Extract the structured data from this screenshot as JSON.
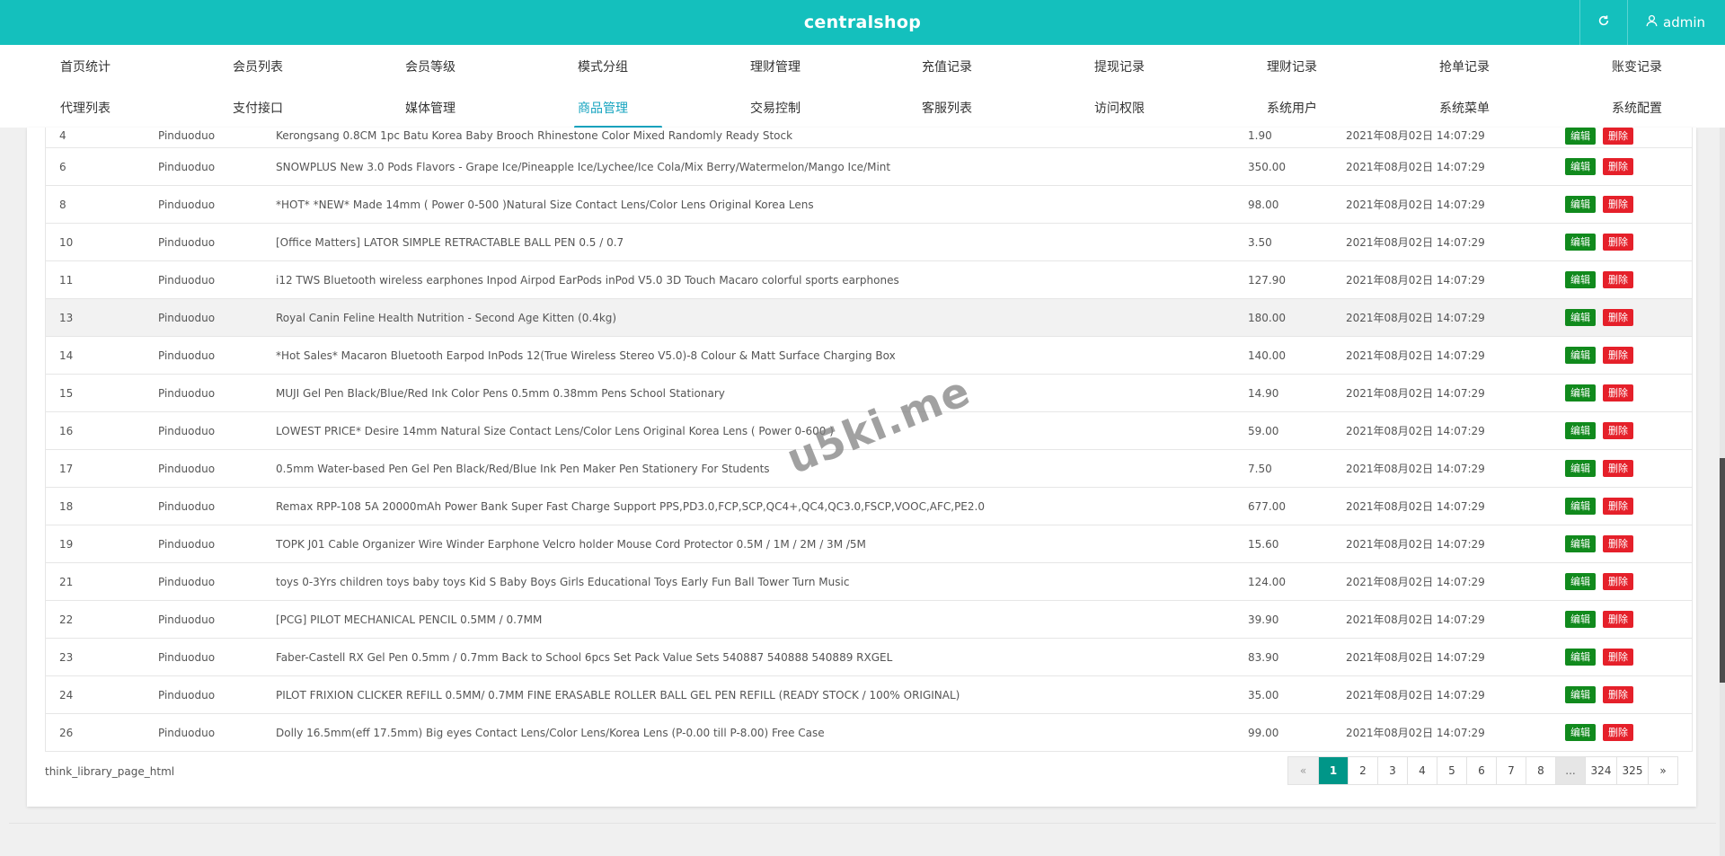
{
  "header": {
    "brand": "centralshop",
    "refresh_icon": "refresh-icon",
    "user_icon": "user-icon",
    "user": "admin"
  },
  "nav": {
    "row1": [
      "首页统计",
      "会员列表",
      "会员等级",
      "模式分组",
      "理财管理",
      "充值记录",
      "提现记录",
      "理财记录",
      "抢单记录",
      "账变记录"
    ],
    "row2": [
      "代理列表",
      "支付接口",
      "媒体管理",
      "商品管理",
      "交易控制",
      "客服列表",
      "访问权限",
      "系统用户",
      "系统菜单",
      "系统配置"
    ],
    "active": "商品管理"
  },
  "table": {
    "edit_label": "编辑",
    "delete_label": "删除",
    "rows": [
      {
        "id": "4",
        "source": "Pinduoduo",
        "name": "Kerongsang 0.8CM 1pc Batu Korea Baby Brooch Rhinestone Color Mixed Randomly Ready Stock",
        "price": "1.90",
        "time": "2021年08月02日 14:07:29"
      },
      {
        "id": "6",
        "source": "Pinduoduo",
        "name": "SNOWPLUS New 3.0 Pods Flavors - Grape Ice/Pineapple Ice/Lychee/Ice Cola/Mix Berry/Watermelon/Mango Ice/Mint",
        "price": "350.00",
        "time": "2021年08月02日 14:07:29"
      },
      {
        "id": "8",
        "source": "Pinduoduo",
        "name": "*HOT* *NEW* Made 14mm ( Power 0-500 )Natural Size Contact Lens/Color Lens Original Korea Lens",
        "price": "98.00",
        "time": "2021年08月02日 14:07:29"
      },
      {
        "id": "10",
        "source": "Pinduoduo",
        "name": "[Office Matters] LATOR SIMPLE RETRACTABLE BALL PEN 0.5 / 0.7",
        "price": "3.50",
        "time": "2021年08月02日 14:07:29"
      },
      {
        "id": "11",
        "source": "Pinduoduo",
        "name": "i12 TWS Bluetooth wireless earphones Inpod Airpod EarPods inPod V5.0 3D Touch Macaro colorful sports earphones",
        "price": "127.90",
        "time": "2021年08月02日 14:07:29"
      },
      {
        "id": "13",
        "source": "Pinduoduo",
        "name": "Royal Canin Feline Health Nutrition - Second Age Kitten (0.4kg)",
        "price": "180.00",
        "time": "2021年08月02日 14:07:29"
      },
      {
        "id": "14",
        "source": "Pinduoduo",
        "name": "*Hot Sales* Macaron Bluetooth Earpod InPods 12(True Wireless Stereo V5.0)-8 Colour & Matt Surface Charging Box",
        "price": "140.00",
        "time": "2021年08月02日 14:07:29"
      },
      {
        "id": "15",
        "source": "Pinduoduo",
        "name": "MUJI Gel Pen Black/Blue/Red Ink Color Pens 0.5mm 0.38mm Pens School Stationary",
        "price": "14.90",
        "time": "2021年08月02日 14:07:29"
      },
      {
        "id": "16",
        "source": "Pinduoduo",
        "name": "LOWEST PRICE* Desire 14mm Natural Size Contact Lens/Color Lens Original Korea Lens ( Power 0-600 )",
        "price": "59.00",
        "time": "2021年08月02日 14:07:29"
      },
      {
        "id": "17",
        "source": "Pinduoduo",
        "name": "0.5mm Water-based Pen Gel Pen Black/Red/Blue Ink Pen Maker Pen Stationery For Students",
        "price": "7.50",
        "time": "2021年08月02日 14:07:29"
      },
      {
        "id": "18",
        "source": "Pinduoduo",
        "name": "Remax RPP-108 5A 20000mAh Power Bank Super Fast Charge Support PPS,PD3.0,FCP,SCP,QC4+,QC4,QC3.0,FSCP,VOOC,AFC,PE2.0",
        "price": "677.00",
        "time": "2021年08月02日 14:07:29"
      },
      {
        "id": "19",
        "source": "Pinduoduo",
        "name": "TOPK J01 Cable Organizer Wire Winder Earphone Velcro holder Mouse Cord Protector 0.5M / 1M / 2M / 3M /5M",
        "price": "15.60",
        "time": "2021年08月02日 14:07:29"
      },
      {
        "id": "21",
        "source": "Pinduoduo",
        "name": "toys 0-3Yrs children toys baby toys Kid S Baby Boys Girls Educational Toys Early Fun Ball Tower Turn Music",
        "price": "124.00",
        "time": "2021年08月02日 14:07:29"
      },
      {
        "id": "22",
        "source": "Pinduoduo",
        "name": "[PCG] PILOT MECHANICAL PENCIL 0.5MM / 0.7MM",
        "price": "39.90",
        "time": "2021年08月02日 14:07:29"
      },
      {
        "id": "23",
        "source": "Pinduoduo",
        "name": "Faber-Castell RX Gel Pen 0.5mm / 0.7mm Back to School 6pcs Set Pack Value Sets 540887 540888 540889 RXGEL",
        "price": "83.90",
        "time": "2021年08月02日 14:07:29"
      },
      {
        "id": "24",
        "source": "Pinduoduo",
        "name": "PILOT FRIXION CLICKER REFILL 0.5MM/ 0.7MM FINE ERASABLE ROLLER BALL GEL PEN REFILL (READY STOCK / 100% ORIGINAL)",
        "price": "35.00",
        "time": "2021年08月02日 14:07:29"
      },
      {
        "id": "26",
        "source": "Pinduoduo",
        "name": "Dolly 16.5mm(eff 17.5mm) Big eyes Contact Lens/Color Lens/Korea Lens (P-0.00 till P-8.00) Free Case",
        "price": "99.00",
        "time": "2021年08月02日 14:07:29"
      }
    ]
  },
  "footer": {
    "page_html": "think_library_page_html",
    "pagination": [
      "«",
      "1",
      "2",
      "3",
      "4",
      "5",
      "6",
      "7",
      "8",
      "...",
      "324",
      "325",
      "»"
    ],
    "current_page": "1"
  },
  "watermark": "u5ki.me"
}
